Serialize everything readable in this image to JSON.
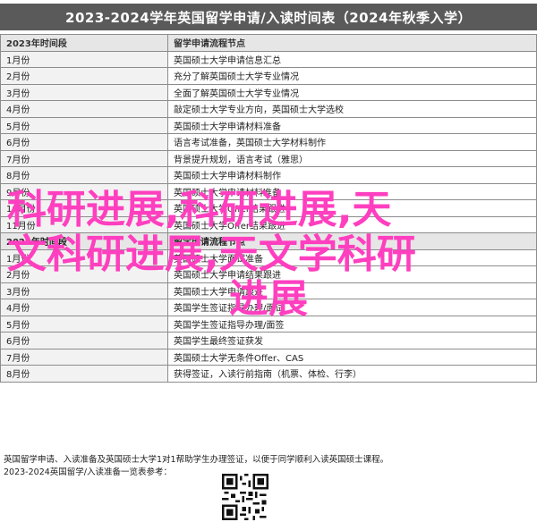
{
  "page": {
    "title": "2023-2024学年英国留学申请/入读时间表（2024年秋季入学）"
  },
  "table": {
    "headers": [
      "2023年时间段",
      "留学申请流程节点"
    ],
    "rows_a": [
      {
        "month": "1月份",
        "item": "英国硕士大学申请信息汇总"
      },
      {
        "month": "2月份",
        "item": "充分了解英国硕士大学专业情况"
      },
      {
        "month": "3月份",
        "item": "全面了解英国硕士大学专业情况"
      },
      {
        "month": "4月份",
        "item": "敲定硕士大学专业方向，英国硕士大学选校"
      },
      {
        "month": "5月份",
        "item": "英国硕士大学申请材料准备"
      },
      {
        "month": "6月份",
        "item": "语言考试准备，英国硕士大学材料制作"
      },
      {
        "month": "7月份",
        "item": "背景提升规划，语言考试（雅思）"
      },
      {
        "month": "8月份",
        "item": "英国硕士大学申请材料制作"
      },
      {
        "month": "9月份",
        "item": "英国硕士大学申请材料准备"
      },
      {
        "month": "10月份",
        "item": "英国硕士大学Offer结果跟进"
      },
      {
        "month": "11月份",
        "item": "英国硕士大学Offer结果跟进"
      }
    ],
    "subhead": {
      "month": "2024年时间段",
      "item": "留学申请流程节点"
    },
    "rows_b": [
      {
        "month": "1月份",
        "item": "英国硕士大学面试准备"
      },
      {
        "month": "2月份",
        "item": "英国硕士大学申请结果跟进"
      },
      {
        "month": "3月份",
        "item": "英国硕士大学申请跟进"
      },
      {
        "month": "4月份",
        "item": "英国学生签证指导办理/面试"
      },
      {
        "month": "5月份",
        "item": "英国学生签证指导办理/面签"
      },
      {
        "month": "6月份",
        "item": "英国学生最终签证获发"
      },
      {
        "month": "7月份",
        "item": "英国硕士大学无条件Offer、CAS"
      },
      {
        "month": "8月份",
        "item": "获得签证，入读行前指南（机票、体检、行李）"
      }
    ]
  },
  "notes": {
    "line1": "英国留学申请、入读准备及英国硕士大学1对1帮助学生办理签证，以便于同学顺利入读英国硕士课程。",
    "line2": "2023-2024英国留学/入读准备一览表参考："
  },
  "overlay": {
    "seg1": "科研进展,科研进展,天",
    "seg2": "文科研进展,天文学科研",
    "seg3": "进展"
  },
  "colors": {
    "title_bg": "#5a5a5a",
    "overlay_text": "#ff3fbf",
    "header_bg": "#e6e6e6"
  },
  "icons": {
    "qr": "qr-code-icon"
  }
}
